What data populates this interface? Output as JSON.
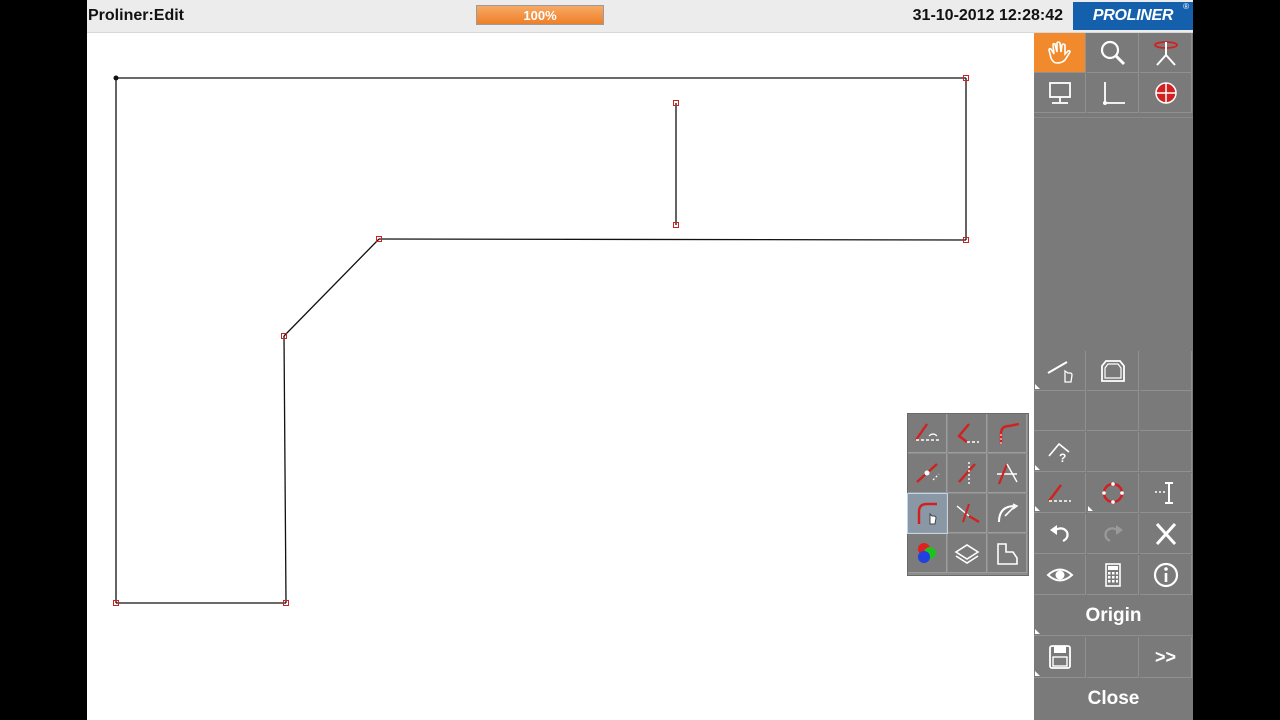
{
  "header": {
    "title": "Proliner:Edit",
    "progress_text": "100%",
    "progress_value": 100,
    "datetime": "31-10-2012 12:28:42",
    "logo_text": "PROLINER",
    "logo_reg": "®"
  },
  "toolbar": {
    "tools": [
      {
        "name": "hand-pan",
        "active": true
      },
      {
        "name": "zoom"
      },
      {
        "name": "probe-stylus"
      },
      {
        "name": "screen-view"
      },
      {
        "name": "axis-corner"
      },
      {
        "name": "target-crosshair"
      }
    ],
    "origin_label": "Origin",
    "close_label": "Close",
    "next_label": ">>"
  },
  "popup_icons": [
    "line-angle-icon",
    "angle-measure-icon",
    "arc-corner-icon",
    "point-line-icon",
    "vertical-line-icon",
    "intersection-icon",
    "curve-select-icon",
    "point-distance-icon",
    "arc-direction-icon",
    "color-icon",
    "layer-icon",
    "profile-shape-icon"
  ],
  "colors": {
    "accent": "#f08a2c",
    "panel": "#7a7a7a",
    "logo": "#1560ad",
    "marker": "#d22020"
  }
}
